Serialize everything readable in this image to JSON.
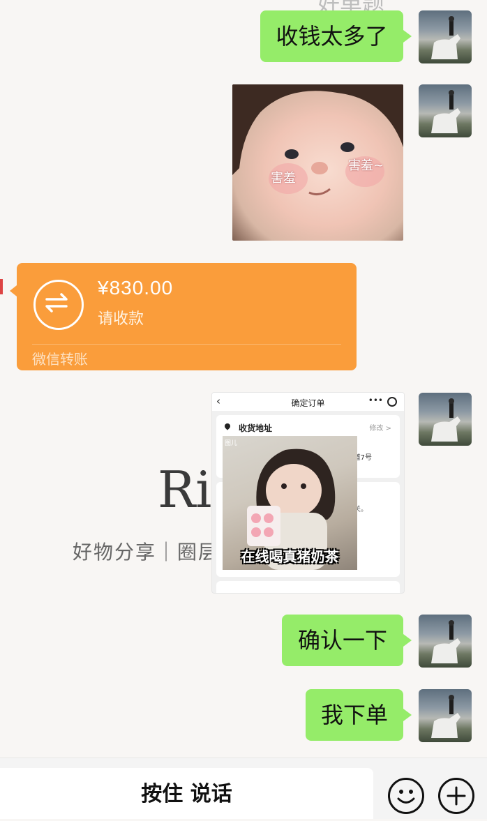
{
  "top_cut_text": "好单题",
  "messages": {
    "m1": "收钱太多了",
    "m2": "确认一下",
    "m3": "我下单"
  },
  "sticker": {
    "caption_left": "害羞",
    "caption_right": "害羞~"
  },
  "transfer": {
    "amount": "¥830.00",
    "note": "请收款",
    "source": "微信转账"
  },
  "background_brand": {
    "big": "Ri",
    "sub": "好物分享｜圈层"
  },
  "order_screenshot": {
    "title": "确定订单",
    "more": "•••",
    "address_label": "收货地址",
    "edit": "修改 >",
    "address_fragment": "道7号",
    "note_fragment": "关。",
    "gif_caption": "在线喝真猪奶茶",
    "gif_corner": "图儿"
  },
  "input_bar": {
    "voice_label": "按住 说话"
  },
  "colors": {
    "bubble_green": "#95ec69",
    "transfer_orange": "#fa9d3b",
    "page_bg": "#f8f6f4"
  }
}
